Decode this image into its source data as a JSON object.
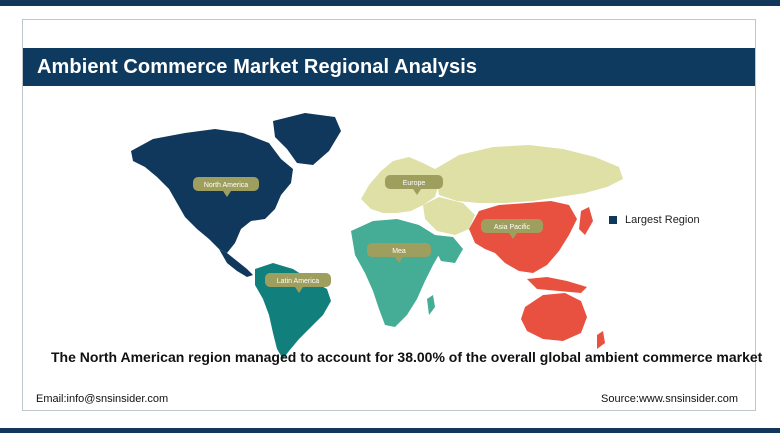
{
  "title": "Ambient Commerce Market Regional Analysis",
  "legend": {
    "label": "Largest Region",
    "color": "#10375c"
  },
  "regions": [
    {
      "key": "north-america",
      "label": "North America",
      "color": "#10375c",
      "largest": true
    },
    {
      "key": "europe",
      "label": "Europe",
      "color": "#dfe0a6",
      "largest": false
    },
    {
      "key": "asia-pacific",
      "label": "Asia Pacific",
      "color": "#e8513f",
      "largest": false
    },
    {
      "key": "mea",
      "label": "Mea",
      "color": "#45ac95",
      "largest": false
    },
    {
      "key": "latin-america",
      "label": "Latin America",
      "color": "#11807c",
      "largest": false
    }
  ],
  "callout_color": "#9e9f5f",
  "footnote": "The North American region managed to account for 38.00% of the overall global ambient commerce market",
  "footer": {
    "email": "Email:info@snsinsider.com",
    "source": "Source:www.snsinsider.com"
  }
}
